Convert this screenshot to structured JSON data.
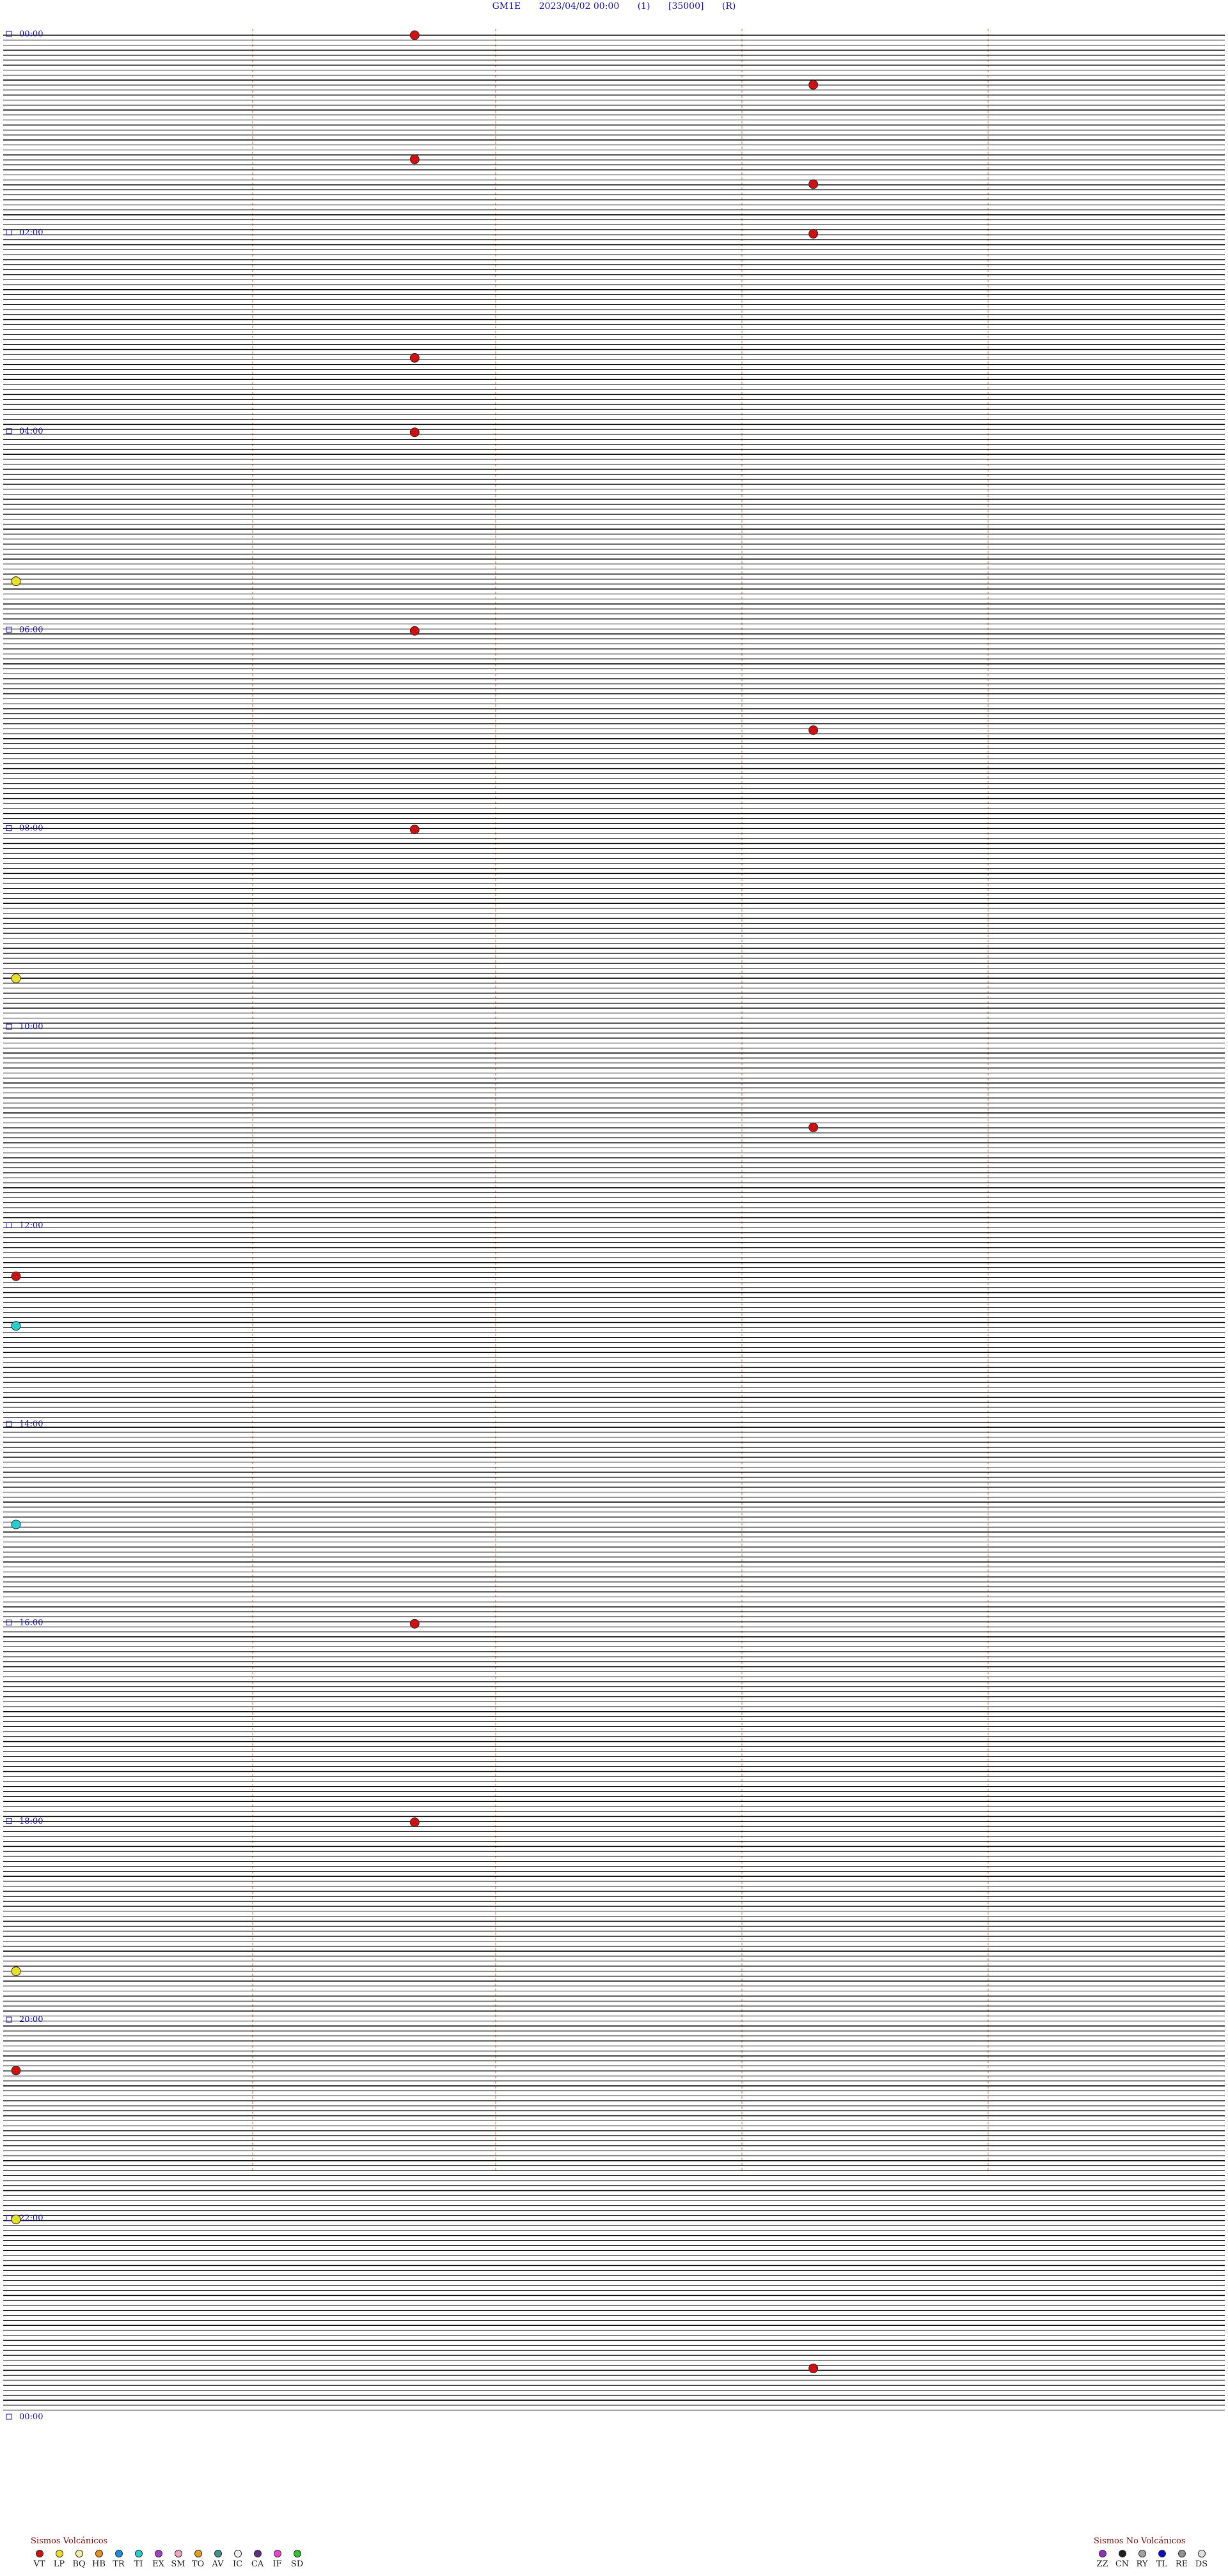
{
  "header": {
    "station": "GM1E",
    "datetime": "2023/04/02 00:00",
    "channel": "(1)",
    "scale": "[35000]",
    "mode": "(R)"
  },
  "chart_data": {
    "type": "scatter",
    "description_axis": "helicorder, 2 hour blocks",
    "hour_labels": [
      "00:00",
      "02:00",
      "04:00",
      "06:00",
      "08:00",
      "10:00",
      "12:00",
      "14:00",
      "16:00",
      "18:00",
      "20:00",
      "22:00",
      "00:00"
    ],
    "minute_markers": [
      "15",
      "30",
      "45",
      "60"
    ],
    "event_colors": {
      "VT": "#d01010",
      "LP": "#e8e020",
      "TR": "#20d0d0",
      "HB": "#e89020",
      "TI": "#2090e0",
      "EX": "#a040c0",
      "SD": "#20c020",
      "ZZ": "#808080"
    },
    "events": [
      {
        "t": "00:05",
        "type": "VT"
      },
      {
        "t": "00:40",
        "type": "VT"
      },
      {
        "t": "01:20",
        "type": "VT"
      },
      {
        "t": "01:40",
        "type": "VT"
      },
      {
        "t": "02:10",
        "type": "VT"
      },
      {
        "t": "03:20",
        "type": "VT"
      },
      {
        "t": "04:05",
        "type": "VT"
      },
      {
        "t": "05:30",
        "type": "LP"
      },
      {
        "t": "06:05",
        "type": "VT"
      },
      {
        "t": "07:10",
        "type": "VT"
      },
      {
        "t": "08:05",
        "type": "VT"
      },
      {
        "t": "09:30",
        "type": "LP"
      },
      {
        "t": "11:10",
        "type": "VT"
      },
      {
        "t": "12:30",
        "type": "VT"
      },
      {
        "t": "13:00",
        "type": "TR"
      },
      {
        "t": "15:00",
        "type": "TR"
      },
      {
        "t": "16:05",
        "type": "VT"
      },
      {
        "t": "18:05",
        "type": "VT"
      },
      {
        "t": "19:30",
        "type": "LP"
      },
      {
        "t": "20:30",
        "type": "VT"
      },
      {
        "t": "22:00",
        "type": "LP"
      },
      {
        "t": "23:40",
        "type": "VT"
      }
    ]
  },
  "legend_volc": {
    "title": "Sismos Volcánicos",
    "items": [
      {
        "code": "VT",
        "color": "#d01010"
      },
      {
        "code": "LP",
        "color": "#e8e020"
      },
      {
        "code": "BQ",
        "color": "#f0f0a0"
      },
      {
        "code": "HB",
        "color": "#e89020"
      },
      {
        "code": "TR",
        "color": "#1890e0"
      },
      {
        "code": "TI",
        "color": "#20d0d0"
      },
      {
        "code": "EX",
        "color": "#a040c0"
      },
      {
        "code": "SM",
        "color": "#f0a0c0"
      },
      {
        "code": "TO",
        "color": "#e0a020"
      },
      {
        "code": "AV",
        "color": "#409090"
      },
      {
        "code": "IC",
        "color": "#f0f0f0"
      },
      {
        "code": "CA",
        "color": "#603080"
      },
      {
        "code": "IF",
        "color": "#f040d0"
      },
      {
        "code": "SD",
        "color": "#30c030"
      }
    ]
  },
  "legend_novolc": {
    "title": "Sismos No Volcánicos",
    "items": [
      {
        "code": "ZZ",
        "color": "#9030c0"
      },
      {
        "code": "CN",
        "color": "#202020"
      },
      {
        "code": "RY",
        "color": "#a0a0a0"
      },
      {
        "code": "TL",
        "color": "#1010c0"
      },
      {
        "code": "RE",
        "color": "#909090"
      },
      {
        "code": "DS",
        "color": "#e0e0e0"
      }
    ]
  }
}
